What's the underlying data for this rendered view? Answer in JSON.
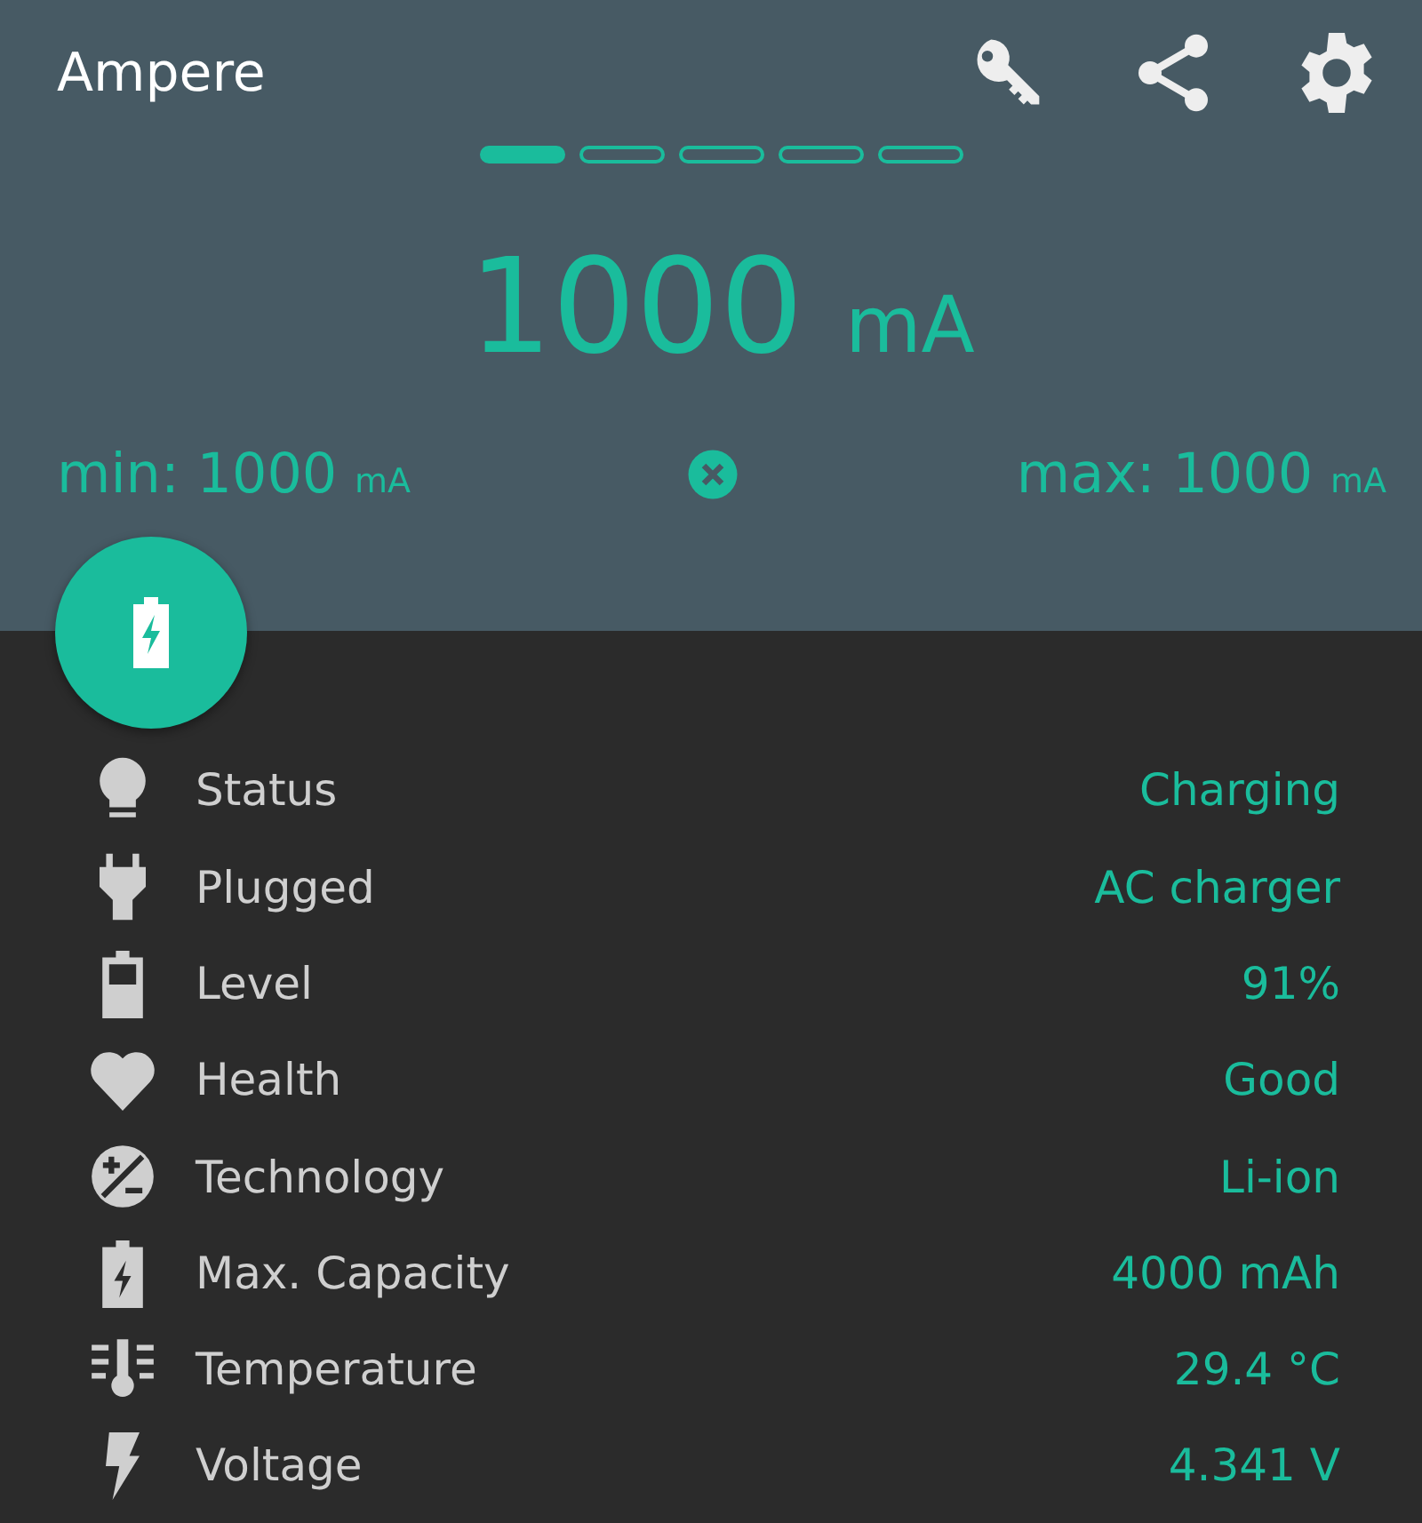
{
  "app_bar": {
    "title": "Ampere"
  },
  "pages": [
    {
      "selected": true
    },
    {
      "selected": false
    },
    {
      "selected": false
    },
    {
      "selected": false
    },
    {
      "selected": false
    }
  ],
  "reading": {
    "value": "1000",
    "unit": "mA"
  },
  "min": {
    "label": "min:",
    "value": "1000",
    "unit": "mA"
  },
  "max": {
    "label": "max:",
    "value": "1000",
    "unit": "mA"
  },
  "details": [
    {
      "label": "Status",
      "value": "Charging"
    },
    {
      "label": "Plugged",
      "value": "AC charger"
    },
    {
      "label": "Level",
      "value": "91%"
    },
    {
      "label": "Health",
      "value": "Good"
    },
    {
      "label": "Technology",
      "value": "Li-ion"
    },
    {
      "label": "Max. Capacity",
      "value": "4000 mAh"
    },
    {
      "label": "Temperature",
      "value": "29.4 °C"
    },
    {
      "label": "Voltage",
      "value": "4.341 V"
    }
  ]
}
